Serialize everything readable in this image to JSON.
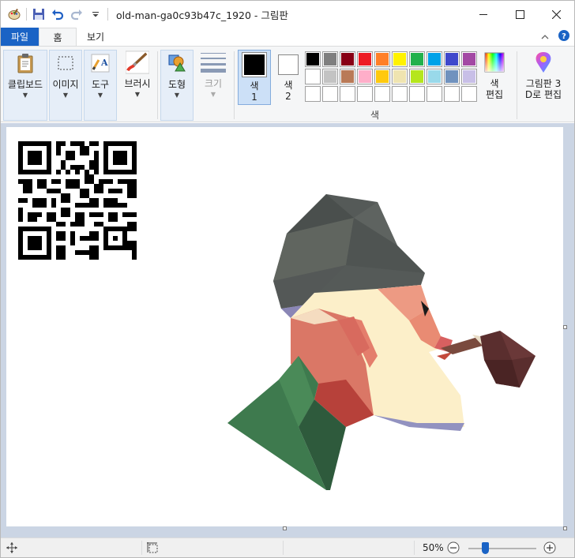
{
  "window": {
    "title": "old-man-ga0c93b47c_1920 - 그림판"
  },
  "tabs": {
    "file": "파일",
    "home": "홈",
    "view": "보기"
  },
  "ribbon": {
    "clipboard": "클립보드",
    "image": "이미지",
    "tools": "도구",
    "brushes": "브러시",
    "shapes": "도형",
    "size": "크기",
    "color1": "색\n1",
    "color1_a": "색",
    "color1_b": "1",
    "color2_a": "색",
    "color2_b": "2",
    "colors_group": "색",
    "edit_colors_a": "색",
    "edit_colors_b": "편집",
    "paint3d_a": "그림판 3",
    "paint3d_b": "D로 편집"
  },
  "palette": {
    "row1": [
      "#000000",
      "#7f7f7f",
      "#880015",
      "#ed1c24",
      "#ff7f27",
      "#fff200",
      "#22b14c",
      "#00a2e8",
      "#3f48cc",
      "#a349a4"
    ],
    "row2": [
      "#ffffff",
      "#c3c3c3",
      "#b97a57",
      "#ffaec9",
      "#ffc90e",
      "#efe4b0",
      "#b5e61d",
      "#99d9ea",
      "#7092be",
      "#c8bfe7"
    ],
    "row3": [
      "#ffffff",
      "#ffffff",
      "#ffffff",
      "#ffffff",
      "#ffffff",
      "#ffffff",
      "#ffffff",
      "#ffffff",
      "#ffffff",
      "#ffffff"
    ],
    "color1_value": "#000000",
    "color2_value": "#ffffff"
  },
  "status": {
    "zoom": "50%",
    "zoom_fraction": 0.5
  }
}
